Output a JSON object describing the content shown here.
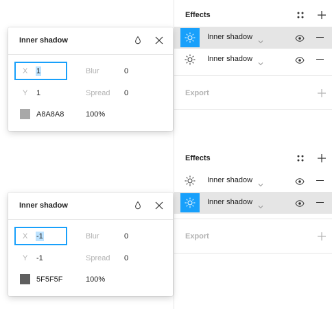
{
  "panels": [
    {
      "effects_title": "Effects",
      "effects": [
        {
          "label": "Inner shadow",
          "icon": "sun-icon",
          "selected": true
        },
        {
          "label": "Inner shadow",
          "icon": "sun-icon",
          "selected": false
        }
      ],
      "export_title": "Export"
    },
    {
      "effects_title": "Effects",
      "effects": [
        {
          "label": "Inner shadow",
          "icon": "sun-icon",
          "selected": false
        },
        {
          "label": "Inner shadow",
          "icon": "sun-icon",
          "selected": true
        }
      ],
      "export_title": "Export"
    }
  ],
  "popovers": [
    {
      "title": "Inner shadow",
      "x_label": "X",
      "x_value": "1",
      "y_label": "Y",
      "y_value": "1",
      "blur_label": "Blur",
      "blur_value": "0",
      "spread_label": "Spread",
      "spread_value": "0",
      "color_hex": "A8A8A8",
      "opacity": "100%",
      "swatch_color": "#A8A8A8"
    },
    {
      "title": "Inner shadow",
      "x_label": "X",
      "x_value": "-1",
      "y_label": "Y",
      "y_value": "-1",
      "blur_label": "Blur",
      "blur_value": "0",
      "spread_label": "Spread",
      "spread_value": "0",
      "color_hex": "5F5F5F",
      "opacity": "100%",
      "swatch_color": "#5F5F5F"
    }
  ],
  "colors": {
    "accent": "#18A0FB",
    "selected_row": "#E5E5E5"
  }
}
